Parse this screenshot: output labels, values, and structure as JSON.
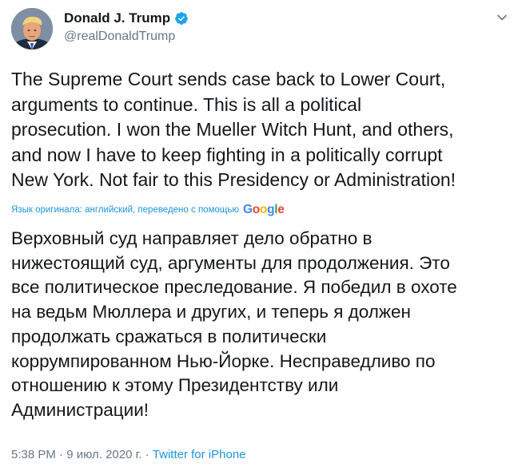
{
  "author": {
    "display_name": "Donald J. Trump",
    "handle": "@realDonaldTrump",
    "verified": true,
    "avatar_icon": "profile-photo"
  },
  "tweet": {
    "text_original": "The Supreme Court sends case back to Lower Court,\narguments to continue. This is all a political\nprosecution. I won the Mueller Witch Hunt, and others,\nand now I have to keep fighting in a politically corrupt\nNew York. Not fair to this Presidency or Administration!",
    "translation_note": "Язык оригинала: английский, переведено с помощью",
    "translation_provider": "Google",
    "text_translated": "Верховный суд направляет дело обратно в\nнижестоящий суд, аргументы для продолжения. Это\nвсе политическое преследование. Я победил в охоте\nна ведьм Мюллера и других, и теперь я должен\nпродолжать сражаться в политически\nкоррумпированном Нью-Йорке. Несправедливо по\nотношению к этому Президентству или\nАдминистрации!",
    "timestamp": "5:38 PM · 9 июл. 2020 г. ·",
    "source": "Twitter for iPhone"
  },
  "icons": {
    "menu": "chevron-down-icon",
    "verified": "verified-badge-icon"
  },
  "colors": {
    "link": "#1b95e0",
    "secondary_text": "#657786",
    "primary_text": "#14171a",
    "google_blue": "#4285f4",
    "google_red": "#ea4335",
    "google_yellow": "#fbbc05",
    "google_green": "#34a853"
  }
}
